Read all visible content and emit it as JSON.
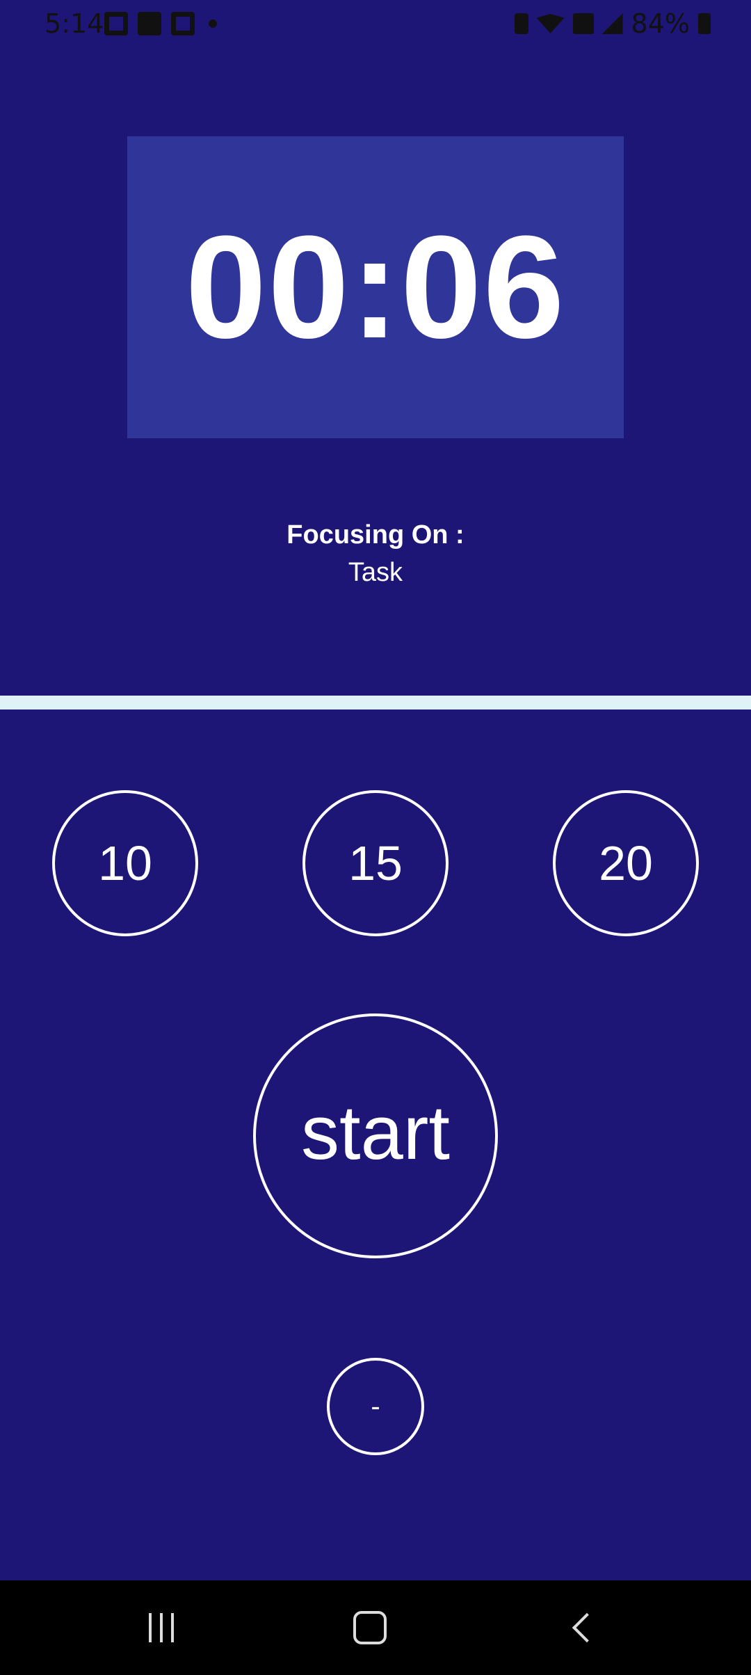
{
  "status_bar": {
    "time": "5:14",
    "battery_percent": "84%",
    "icons": [
      "gallery-icon",
      "linkedin-icon",
      "calendar-icon",
      "dot-icon",
      "battery-saver-icon",
      "wifi-icon",
      "volte-icon",
      "signal-icon",
      "battery-icon"
    ]
  },
  "timer": {
    "display": "00:06"
  },
  "focus": {
    "title": "Focusing On :",
    "task": "Task"
  },
  "presets": [
    "10",
    "15",
    "20"
  ],
  "controls": {
    "start_label": "start",
    "minus_label": "-"
  },
  "colors": {
    "background": "#1e1677",
    "timer_box": "#303599",
    "divider": "#dff3f7",
    "text": "#ffffff",
    "nav_bar": "#000000"
  }
}
